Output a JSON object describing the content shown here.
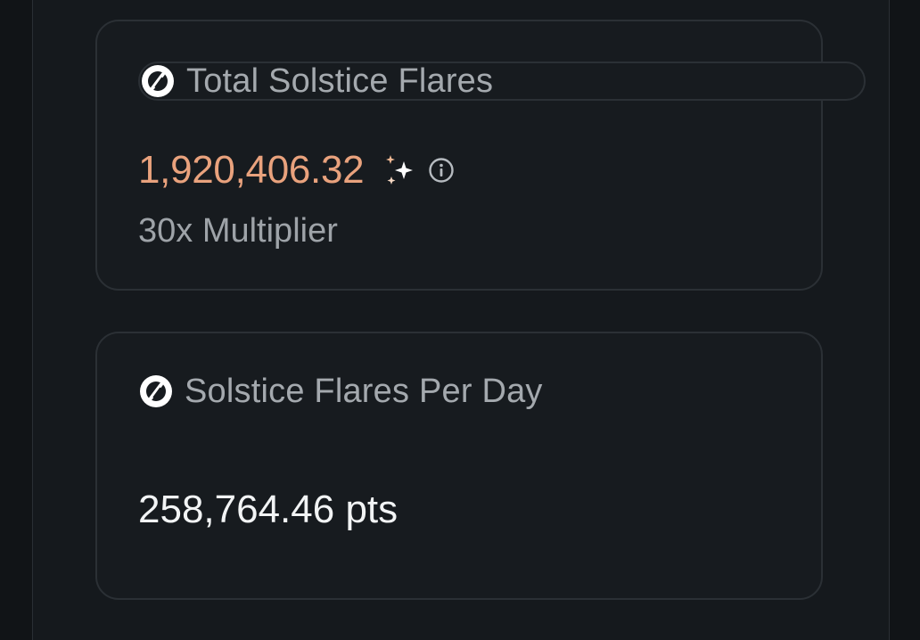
{
  "cards": {
    "total": {
      "title": "Total Solstice Flares",
      "value": "1,920,406.32",
      "multiplier": "30x Multiplier",
      "icon": "solstice-logo-icon"
    },
    "per_day": {
      "title": "Solstice Flares Per Day",
      "value": "258,764.46 pts",
      "icon": "solstice-logo-icon"
    }
  },
  "colors": {
    "background": "#111417",
    "card_background": "#171b1f",
    "card_border": "#2b3035",
    "accent_orange": "#e9a27d",
    "muted_text": "#a4a9ae",
    "primary_text": "#f2f4f5"
  }
}
